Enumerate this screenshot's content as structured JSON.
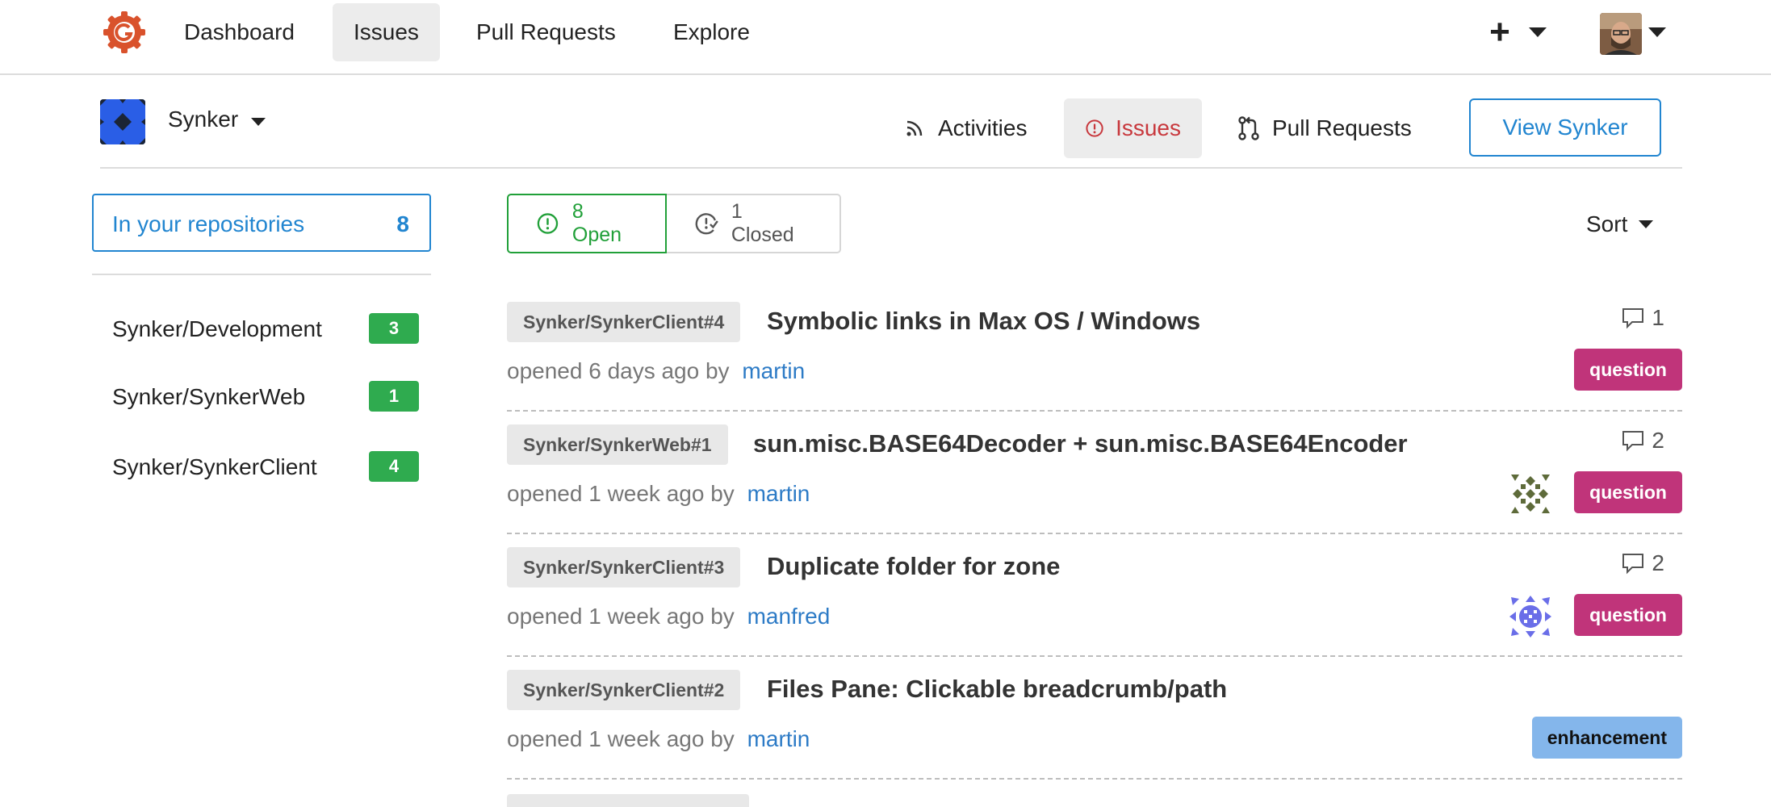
{
  "nav": {
    "items": [
      "Dashboard",
      "Issues",
      "Pull Requests",
      "Explore"
    ],
    "active": "Issues"
  },
  "org": {
    "name": "Synker",
    "tabs": [
      {
        "label": "Activities",
        "icon": "rss-icon"
      },
      {
        "label": "Issues",
        "icon": "issue-opened-icon"
      },
      {
        "label": "Pull Requests",
        "icon": "git-pull-request-icon"
      }
    ],
    "view_button": "View Synker"
  },
  "sidebar": {
    "filter_label": "In your repositories",
    "filter_count": "8",
    "repos": [
      {
        "name": "Synker/Development",
        "count": "3"
      },
      {
        "name": "Synker/SynkerWeb",
        "count": "1"
      },
      {
        "name": "Synker/SynkerClient",
        "count": "4"
      }
    ]
  },
  "toolbar": {
    "open_label": "8 Open",
    "closed_label": "1 Closed",
    "sort_label": "Sort"
  },
  "colors": {
    "accent": "#2185d0",
    "open_green": "#21a039",
    "question_label": "#c0347a",
    "enhancement_label": "#84b6eb",
    "active_issue_tab": "#c8383d",
    "badge_green": "#2fab4f"
  },
  "issues": [
    {
      "ref": "Synker/SynkerClient#4",
      "title": "Symbolic links in Max OS / Windows",
      "opened": "opened 6 days ago by",
      "author": "martin",
      "comments": "1",
      "label": "question"
    },
    {
      "ref": "Synker/SynkerWeb#1",
      "title": "sun.misc.BASE64Decoder + sun.misc.BASE64Encoder",
      "opened": "opened 1 week ago by",
      "author": "martin",
      "comments": "2",
      "label": "question"
    },
    {
      "ref": "Synker/SynkerClient#3",
      "title": "Duplicate folder for zone",
      "opened": "opened 1 week ago by",
      "author": "manfred",
      "comments": "2",
      "label": "question"
    },
    {
      "ref": "Synker/SynkerClient#2",
      "title": "Files Pane: Clickable breadcrumb/path",
      "opened": "opened 1 week ago by",
      "author": "martin",
      "comments": "",
      "label": "enhancement"
    }
  ]
}
